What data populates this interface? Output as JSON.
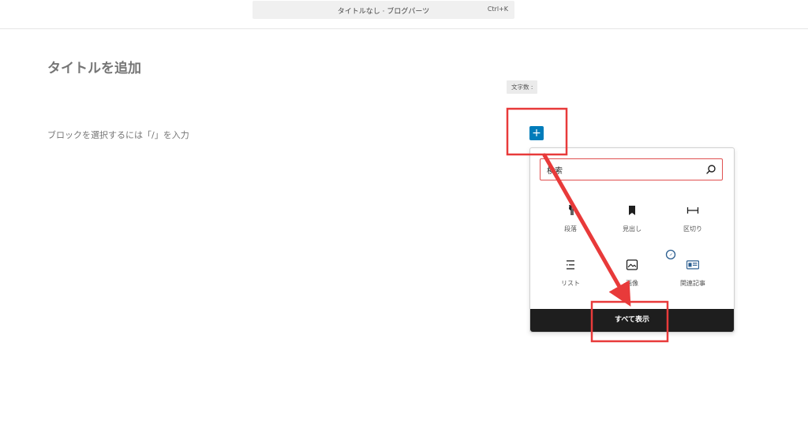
{
  "header": {
    "document_title": "タイトルなし · ブログパーツ",
    "shortcut": "Ctrl+K"
  },
  "editor": {
    "title_placeholder": "タイトルを追加",
    "block_placeholder": "ブロックを選択するには「/」を入力",
    "char_count_label": "文字数 :"
  },
  "add_block": {
    "symbol": "+"
  },
  "inserter": {
    "search_value": "検索",
    "blocks": [
      {
        "label": "段落",
        "icon": "paragraph-icon"
      },
      {
        "label": "見出し",
        "icon": "heading-icon"
      },
      {
        "label": "区切り",
        "icon": "separator-icon"
      },
      {
        "label": "リスト",
        "icon": "list-icon"
      },
      {
        "label": "画像",
        "icon": "image-icon"
      },
      {
        "label": "関連記事",
        "icon": "related-posts-icon"
      }
    ],
    "show_all_label": "すべて表示"
  },
  "annotations": {
    "color": "#e83a3a"
  },
  "colors": {
    "primary": "#007cba",
    "dark": "#1e1e1e",
    "muted_text": "#757575"
  }
}
